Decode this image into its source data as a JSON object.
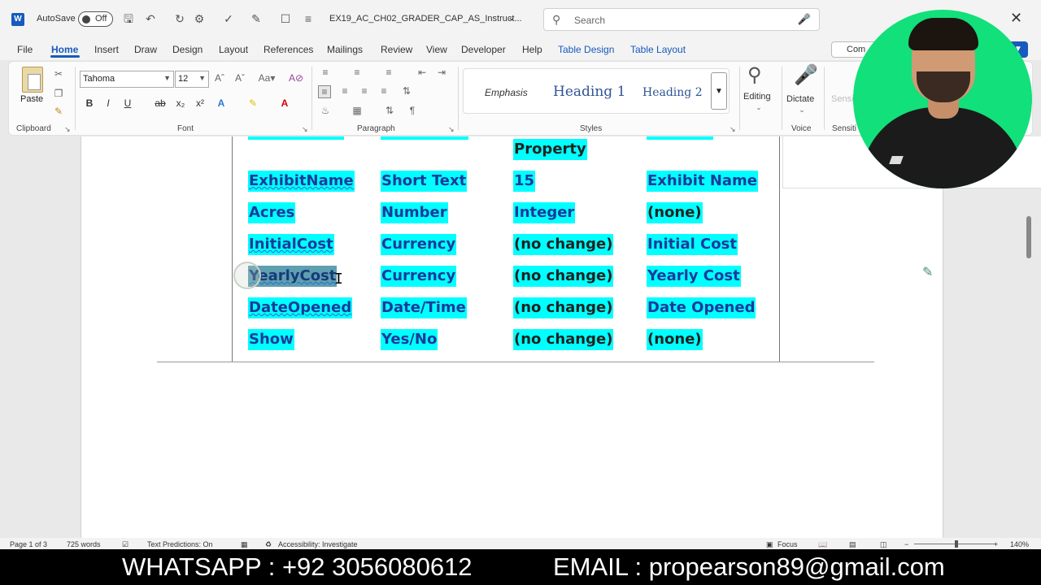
{
  "titlebar": {
    "autosave_label": "AutoSave",
    "autosave_state": "Off",
    "doc_title": "EX19_AC_CH02_GRADER_CAP_AS_Instruct...",
    "search_placeholder": "Search"
  },
  "menu": {
    "tabs": [
      "File",
      "Home",
      "Insert",
      "Draw",
      "Design",
      "Layout",
      "References",
      "Mailings",
      "Review",
      "View",
      "Developer",
      "Help",
      "Table Design",
      "Table Layout"
    ],
    "active": "Home",
    "comment_label": "Com"
  },
  "ribbon": {
    "clipboard": {
      "paste_label": "Paste",
      "group_label": "Clipboard"
    },
    "font": {
      "font_name": "Tahoma",
      "font_size": "12",
      "group_label": "Font"
    },
    "paragraph": {
      "group_label": "Paragraph"
    },
    "styles": {
      "items": [
        "Emphasis",
        "Heading 1",
        "Heading 2"
      ],
      "group_label": "Styles"
    },
    "editing": {
      "label": "Editing"
    },
    "voice": {
      "dictate_label": "Dictate",
      "group_label": "Voice"
    },
    "sensitivity": {
      "label": "Sensi",
      "group_label": "Sensiti"
    }
  },
  "table": {
    "partial_row_text": "Property",
    "rows": [
      [
        "ExhibitName",
        "Short Text",
        "15",
        "Exhibit Name"
      ],
      [
        "Acres",
        "Number",
        "Integer",
        "(none)"
      ],
      [
        "InitialCost",
        "Currency",
        "(no change)",
        "Initial Cost"
      ],
      [
        "YearlyCost",
        "Currency",
        "(no change)",
        "Yearly Cost"
      ],
      [
        "DateOpened",
        "Date/Time",
        "(no change)",
        "Date Opened"
      ],
      [
        "Show",
        "Yes/No",
        "(no change)",
        "(none)"
      ]
    ]
  },
  "statusbar": {
    "page": "Page 1 of 3",
    "words": "725 words",
    "text_predictions": "Text Predictions: On",
    "accessibility": "Accessibility: Investigate",
    "focus": "Focus",
    "zoom": "140%"
  },
  "banner": {
    "whatsapp": "WHATSAPP : +92 3056080612",
    "email": "EMAIL : propearson89@gmail.com"
  },
  "colors": {
    "accent": "#185abd",
    "highlight": "#00ffff",
    "webcam_bg": "#12e07a"
  }
}
